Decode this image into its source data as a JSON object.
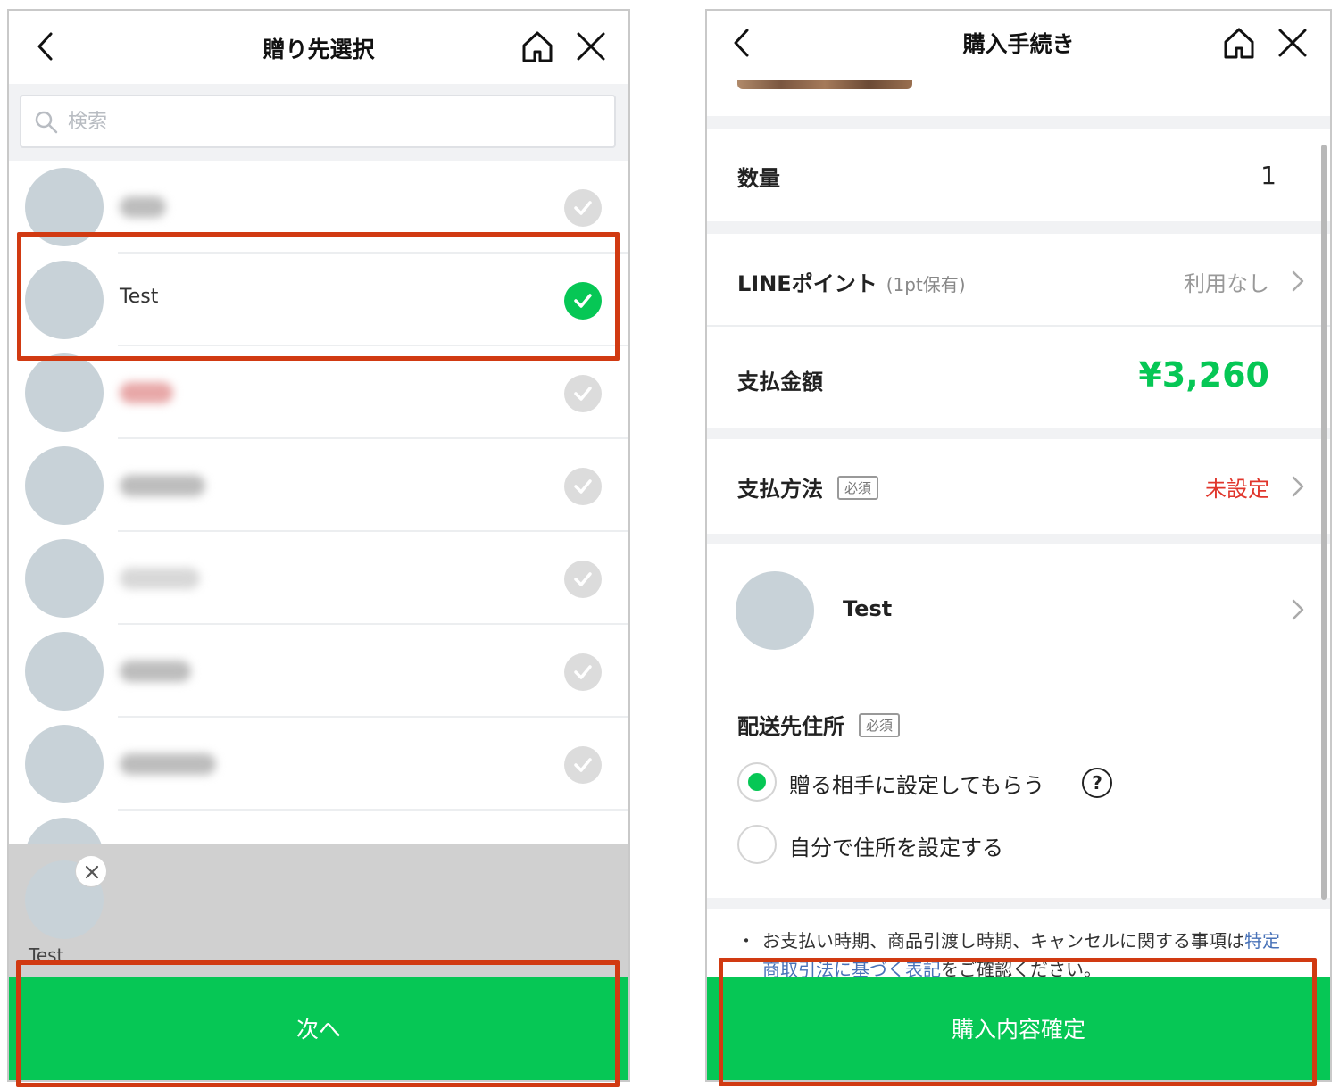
{
  "left": {
    "header": {
      "title": "贈り先選択",
      "back_icon": "chevron-left-icon",
      "home_icon": "home-icon",
      "close_icon": "close-icon"
    },
    "search": {
      "placeholder": "検索",
      "icon": "search-icon"
    },
    "friends": [
      {
        "name": "",
        "blurred": true,
        "selected": false
      },
      {
        "name": "Test",
        "blurred": false,
        "selected": true
      },
      {
        "name": "",
        "blurred": true,
        "selected": false
      },
      {
        "name": "",
        "blurred": true,
        "selected": false
      },
      {
        "name": "",
        "blurred": true,
        "selected": false
      },
      {
        "name": "",
        "blurred": true,
        "selected": false
      },
      {
        "name": "",
        "blurred": true,
        "selected": false
      }
    ],
    "selected_panel": {
      "name": "Test"
    },
    "next_button": "次へ"
  },
  "right": {
    "header": {
      "title": "購入手続き",
      "back_icon": "chevron-left-icon",
      "home_icon": "home-icon",
      "close_icon": "close-icon"
    },
    "quantity": {
      "label": "数量",
      "value": "1"
    },
    "line_points": {
      "label": "LINEポイント",
      "sub": "(1pt保有)",
      "value": "利用なし"
    },
    "amount": {
      "label": "支払金額",
      "value": "¥3,260"
    },
    "payment_method": {
      "label": "支払方法",
      "badge": "必須",
      "value": "未設定"
    },
    "recipient": {
      "name": "Test"
    },
    "shipping": {
      "label": "配送先住所",
      "badge": "必須",
      "options": [
        {
          "label": "贈る相手に設定してもらう",
          "selected": true
        },
        {
          "label": "自分で住所を設定する",
          "selected": false
        }
      ],
      "help": "?"
    },
    "notice": {
      "bullet": "・",
      "text1": "お支払い時期、商品引渡し時期、キャンセルに関する事項は",
      "link": "特定商取引法に基づく表記",
      "text2": "をご確認ください。"
    },
    "confirm_button": "購入内容確定"
  },
  "colors": {
    "accent": "#06c755",
    "price": "#06c755",
    "unset": "#e0352b",
    "highlight": "#d13a12"
  }
}
